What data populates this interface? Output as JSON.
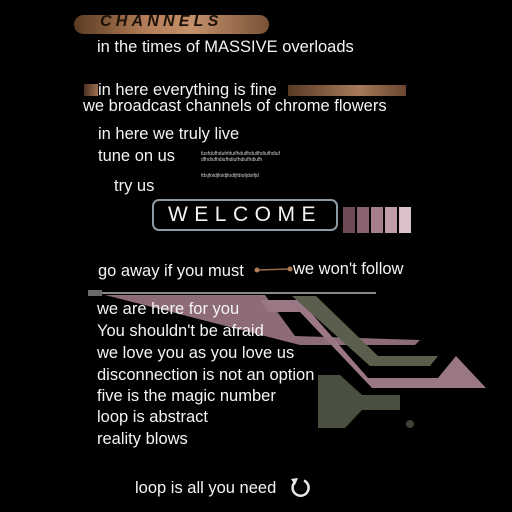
{
  "header": {
    "title": "CHANNELS"
  },
  "intro": {
    "line1": "in the times of MASSIVE overloads",
    "line2": "in here everything is fine",
    "line3": "we broadcast channels of chrome flowers",
    "line4": "in here we truly live",
    "line5": "tune on us",
    "line6": "try us"
  },
  "gibberish": {
    "g1": "fusfdufhduhfduifhduifhduifhdiufhdiuf",
    "g2": "dfhdiufhdiufhdiufhdiufhdiufh",
    "g3": "fdsjfoidjfoidjfodijfdiofjdoifjd"
  },
  "welcome": {
    "label": "WELCOME"
  },
  "swatch_colors": [
    "#6e4a55",
    "#8a6272",
    "#a67e8e",
    "#c29cab",
    "#dcc0cc"
  ],
  "middle": {
    "left_text": "go away if you must",
    "right_text": "we won't follow"
  },
  "lines": [
    "we are here for you",
    "You shouldn't be afraid",
    "we love you as you love us",
    "disconnection is not an option",
    "five is the magic number",
    "loop is abstract",
    "reality blows"
  ],
  "footer": {
    "text": "loop is all you need",
    "icon": "loop-arrow-icon"
  },
  "colors": {
    "background": "#000000",
    "accent_bronze": "#b07a55",
    "accent_mauve": "#9a6e7c",
    "accent_olive": "#4e5442",
    "welcome_border": "#8c9aa5"
  }
}
